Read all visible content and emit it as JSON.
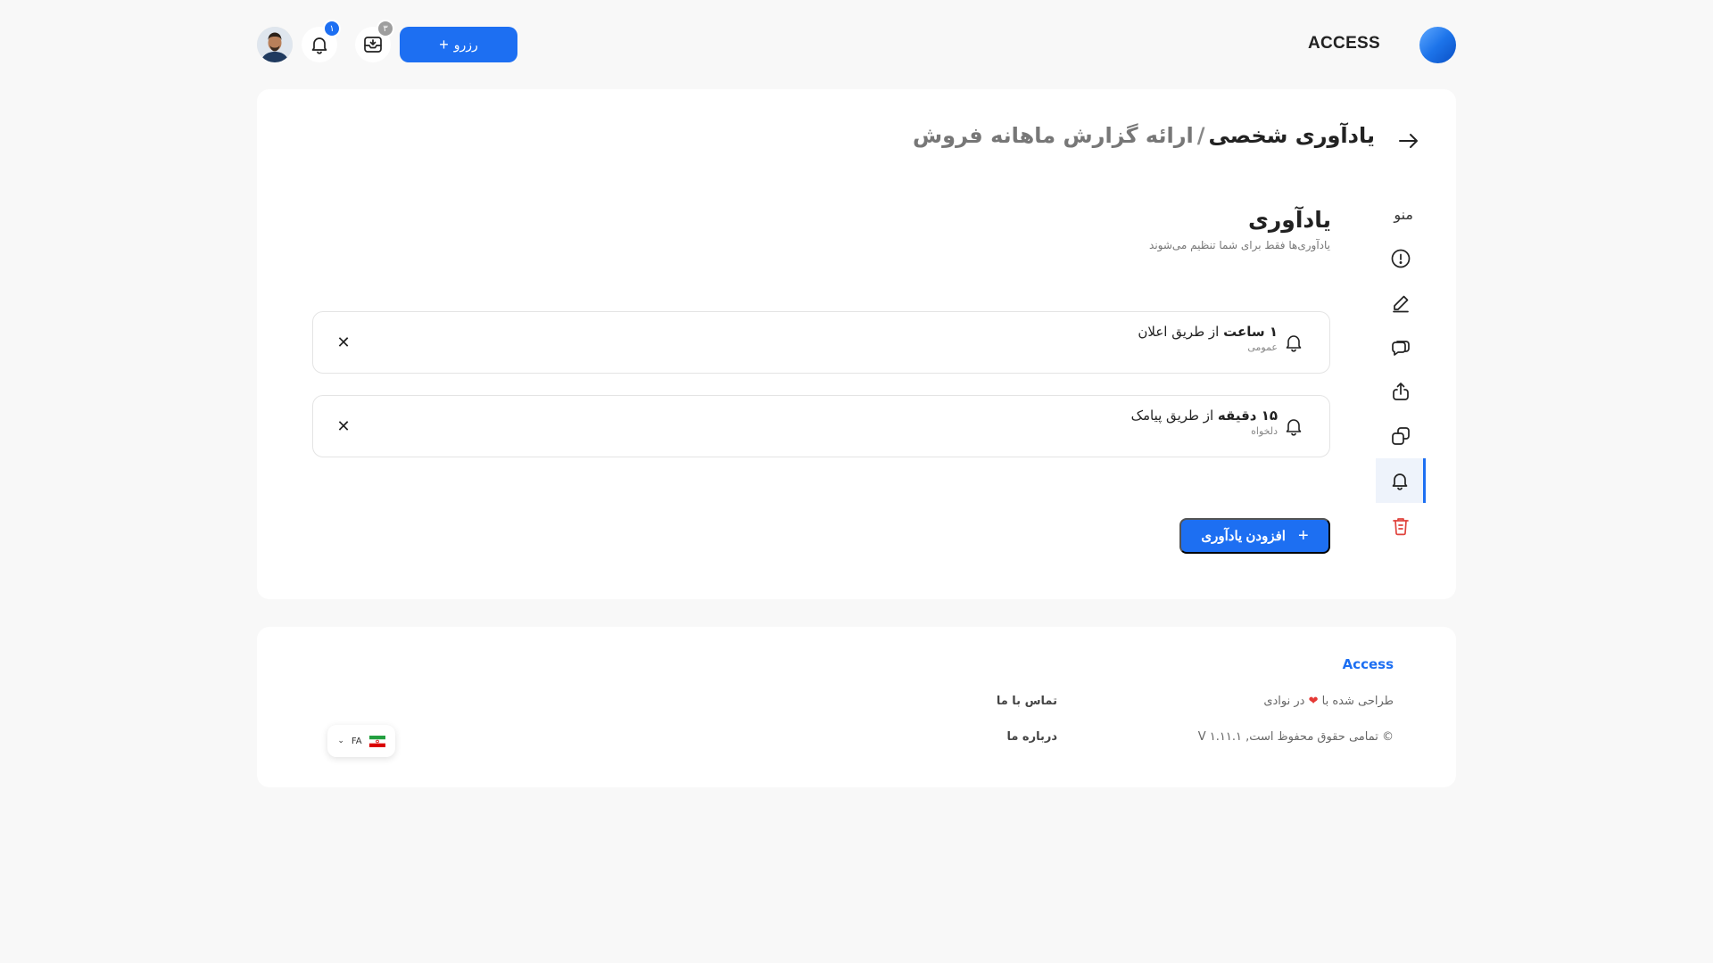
{
  "header": {
    "logo_text": "ACCESS",
    "reserve_button": "رزرو",
    "inbox_badge": "۳",
    "notifications_badge": "۱"
  },
  "breadcrumb": {
    "current": "یادآوری شخصی",
    "separator": "/",
    "parent": "ارائه گزارش ماهانه فروش"
  },
  "sidebar": {
    "title": "منو",
    "items": [
      {
        "icon": "info-icon"
      },
      {
        "icon": "edit-icon"
      },
      {
        "icon": "comment-icon"
      },
      {
        "icon": "share-icon"
      },
      {
        "icon": "copy-icon"
      },
      {
        "icon": "bell-icon",
        "active": true
      },
      {
        "icon": "trash-icon"
      }
    ]
  },
  "section": {
    "title": "یادآوری",
    "subtitle": "یادآوری‌ها فقط برای شما تنظیم می‌شوند"
  },
  "reminders": [
    {
      "amount": "۱ ساعت",
      "channel": "از طریق اعلان",
      "type": "عمومی"
    },
    {
      "amount": "۱۵ دقیقه",
      "channel": "از طریق پیامک",
      "type": "دلخواه"
    }
  ],
  "add_button": "افزودن یادآوری",
  "footer": {
    "brand": "Access",
    "designed_prefix": "طراحی شده با",
    "designed_suffix": "در نوادی",
    "copyright": "© تمامی حقوق محفوظ است, V ۱.۱۱.۱",
    "contact": "تماس با ما",
    "about": "درباره ما",
    "language": "FA"
  },
  "colors": {
    "accent": "#1d6ff2",
    "danger": "#e0433d",
    "heart": "#e53935"
  }
}
